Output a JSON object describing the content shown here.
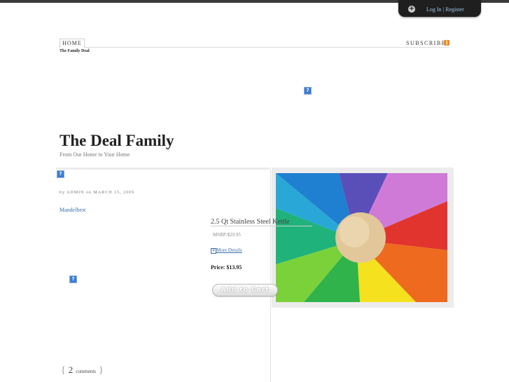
{
  "topbar": {
    "login_label": "Log In | Register"
  },
  "nav": {
    "home_label": "HOME",
    "subscribe_label": "SUBSCRIBE"
  },
  "site": {
    "tag": "The Family Deal",
    "title": "The Deal Family",
    "tagline": "From Our Home to Your Home"
  },
  "post": {
    "meta": "by ADMIN on MARCH 15, 2009",
    "category": "Mandelbrot",
    "comments_count": "2",
    "comments_label": "comments"
  },
  "product": {
    "name": "2.5 Qt Stainless Steel Kettle",
    "msrp": "MSRP:$29.95",
    "more_details": "More Details",
    "price": "Price: $13.95",
    "add_to_cart": "Add to Cart"
  },
  "broken_image_glyph": "?",
  "colors": {
    "link": "#3a6fa6",
    "login_bar": "#1f1f1f",
    "rss": "#f08a24",
    "broken_image": "#3d7bd6"
  },
  "icons": [
    "plus-icon",
    "rss-icon",
    "broken-image-icon",
    "expand-icon"
  ]
}
